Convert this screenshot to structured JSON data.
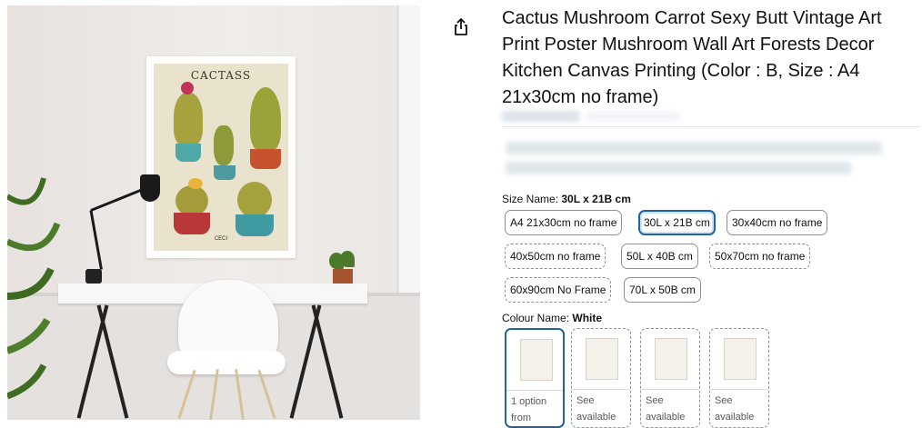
{
  "product": {
    "title": "Cactus Mushroom Carrot Sexy Butt Vintage Art Print Poster Mushroom Wall Art Forests Decor Kitchen Canvas Printing (Color : B, Size : A4 21x30cm no frame)"
  },
  "image": {
    "poster_title": "CACTASS",
    "poster_signature": "CECI"
  },
  "icons": {
    "share": "share-icon"
  },
  "size": {
    "label": "Size Name:",
    "selected": "30L x 21B cm",
    "options": [
      {
        "label": "A4 21x30cm no frame"
      },
      {
        "label": "30L x 21B cm"
      },
      {
        "label": "30x40cm no frame"
      },
      {
        "label": "40x50cm no frame"
      },
      {
        "label": "50L x 40B cm"
      },
      {
        "label": "50x70cm no frame"
      },
      {
        "label": "60x90cm No Frame"
      },
      {
        "label": "70L x 50B cm"
      }
    ]
  },
  "colour": {
    "label": "Colour Name:",
    "selected": "White",
    "swatches": [
      {
        "line1": "1 option",
        "line2": "from"
      },
      {
        "line1": "See",
        "line2": "available"
      },
      {
        "line1": "See",
        "line2": "available"
      },
      {
        "line1": "See",
        "line2": "available"
      }
    ]
  },
  "colors": {
    "selected_border": "#2162a1",
    "text": "#0f1111",
    "muted_text": "#565959"
  }
}
